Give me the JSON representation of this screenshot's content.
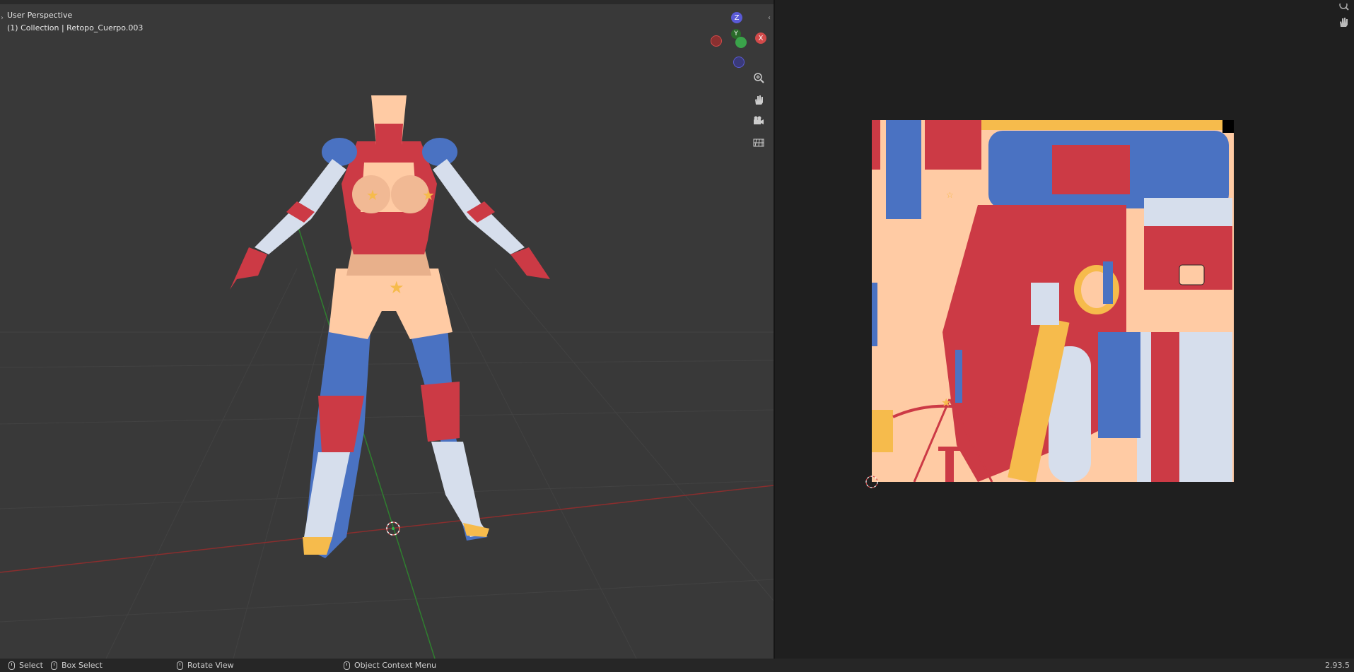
{
  "viewport": {
    "perspective": "User Perspective",
    "collection": "(1) Collection | Retopo_Cuerpo.003",
    "gizmo": {
      "z": "Z",
      "y": "Y",
      "x": "X"
    },
    "nav_icons": [
      "zoom-icon",
      "hand-pan-icon",
      "camera-icon",
      "ortho-grid-icon"
    ]
  },
  "status": {
    "select": "Select",
    "box_select": "Box Select",
    "rotate_view": "Rotate View",
    "context_menu": "Object Context Menu",
    "version": "2.93.5"
  },
  "colors": {
    "viewport_bg": "#393939",
    "editor_bg": "#1f1f1f",
    "red": "#cc3a45",
    "blue": "#4a72c2",
    "skin": "#ffcba4",
    "white": "#d6deec",
    "gold": "#f6bb4c",
    "axis_x": "#d14a4a",
    "axis_y": "#3aa34a",
    "axis_z": "#5a5ad6"
  }
}
